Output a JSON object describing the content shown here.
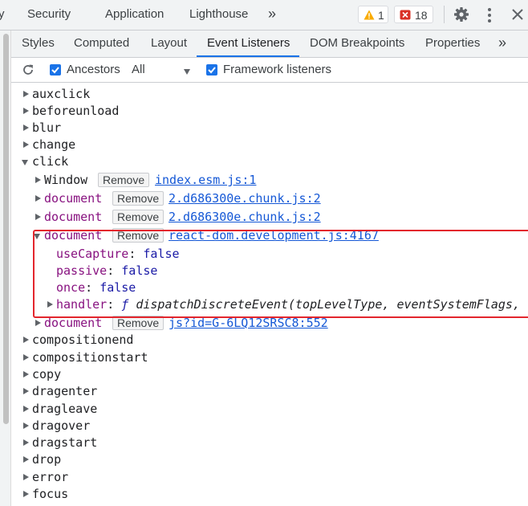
{
  "top_tabs": [
    "y",
    "Security",
    "Application",
    "Lighthouse"
  ],
  "top_more": "»",
  "warnings_count": "1",
  "errors_count": "18",
  "sub_tabs": [
    "Styles",
    "Computed",
    "Layout",
    "Event Listeners",
    "DOM Breakpoints",
    "Properties"
  ],
  "sub_more": "»",
  "active_sub_tab": "Event Listeners",
  "toolbar": {
    "ancestors_label": "Ancestors",
    "ancestors_checked": true,
    "filter_value": "All",
    "framework_label": "Framework listeners",
    "framework_checked": true
  },
  "events_before": [
    "auxclick",
    "beforeunload",
    "blur",
    "change"
  ],
  "expanded_event": "click",
  "remove_label": "Remove",
  "listeners": [
    {
      "node": "Window",
      "source": "index.esm.js:1"
    },
    {
      "node": "document",
      "source": "2.d686300e.chunk.js:2"
    },
    {
      "node": "document",
      "source": "2.d686300e.chunk.js:2"
    },
    {
      "node": "document",
      "source": "react-dom.development.js:4167"
    },
    {
      "node": "document",
      "source": "js?id=G-6LQ12SRSC8:552"
    }
  ],
  "props": {
    "useCapture_key": "useCapture",
    "useCapture_val": "false",
    "passive_key": "passive",
    "passive_val": "false",
    "once_key": "once",
    "once_val": "false",
    "handler_key": "handler",
    "handler_f": "ƒ",
    "handler_val": "dispatchDiscreteEvent(topLevelType, eventSystemFlags,"
  },
  "events_after": [
    "compositionend",
    "compositionstart",
    "copy",
    "dragenter",
    "dragleave",
    "dragover",
    "dragstart",
    "drop",
    "error",
    "focus"
  ]
}
